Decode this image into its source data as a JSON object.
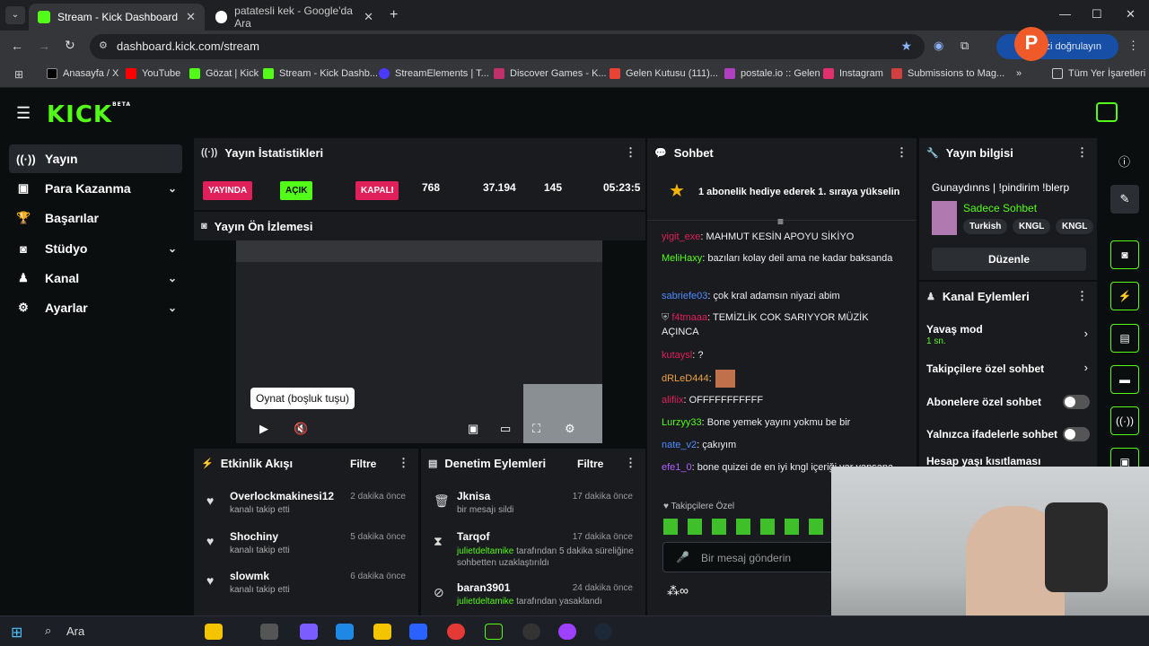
{
  "browser": {
    "tabs": [
      {
        "title": "Stream - Kick Dashboard"
      },
      {
        "title": "patatesli kek - Google'da Ara"
      }
    ],
    "url": "dashboard.kick.com/stream",
    "profile_prompt": "nizi doğrulayın",
    "bookmarks": [
      "Anasayfa / X",
      "YouTube",
      "Gözat | Kick",
      "Stream - Kick Dashb...",
      "StreamElements | T...",
      "Discover Games - K...",
      "Gelen Kutusu (111)...",
      "postale.io :: Gelen",
      "Instagram",
      "Submissions to Mag..."
    ],
    "all_bookmarks": "Tüm Yer İşaretleri"
  },
  "kick": {
    "logo": "KICK",
    "beta": "BETA"
  },
  "sidebar": {
    "items": [
      {
        "label": "Yayın"
      },
      {
        "label": "Para Kazanma"
      },
      {
        "label": "Başarılar"
      },
      {
        "label": "Stüdyo"
      },
      {
        "label": "Kanal"
      },
      {
        "label": "Ayarlar"
      }
    ]
  },
  "stats": {
    "title": "Yayın İstatistikleri",
    "live": "YAYINDA",
    "on": "AÇIK",
    "off": "KAPALI",
    "viewers": "768",
    "followers": "37.194",
    "subs": "145",
    "duration": "05:23:5"
  },
  "preview": {
    "title": "Yayın Ön İzlemesi",
    "tooltip": "Oynat (boşluk tuşu)"
  },
  "activity": {
    "title": "Etkinlik Akışı",
    "filter": "Filtre",
    "items": [
      {
        "name": "Overlockmakinesi12",
        "sub": "kanalı takip etti",
        "time": "2 dakika önce"
      },
      {
        "name": "Shochiny",
        "sub": "kanalı takip etti",
        "time": "5 dakika önce"
      },
      {
        "name": "slowmk",
        "sub": "kanalı takip etti",
        "time": "6 dakika önce"
      }
    ]
  },
  "moderation": {
    "title": "Denetim Eylemleri",
    "filter": "Filtre",
    "items": [
      {
        "name": "Jknisa",
        "sub": "bir mesajı sildi",
        "time": "17 dakika önce"
      },
      {
        "name": "Tarqof",
        "actor": "julietdeltamike",
        "sub": " tarafından 5 dakika süreliğine sohbetten uzaklaştırıldı",
        "time": "17 dakika önce"
      },
      {
        "name": "baran3901",
        "actor": "julietdeltamike",
        "sub": " tarafından yasaklandı",
        "time": "24 dakika önce"
      }
    ]
  },
  "chat": {
    "title": "Sohbet",
    "pinned": "1 abonelik hediye ederek 1. sıraya yükselin",
    "messages": [
      {
        "user": "yigit_exe",
        "color": "#e0205a",
        "text": ": MAHMUT KESİN APOYU SİKİYO"
      },
      {
        "user": "MeliHaxy",
        "color": "#53fc18",
        "text": ": bazıları kolay deil ama ne kadar baksanda"
      },
      {
        "user": "sabriefe03",
        "color": "#4e8cff",
        "text": ": çok kral adamsın niyazi abim"
      },
      {
        "user": "f4tmaaa",
        "color": "#e0205a",
        "text": ": TEMİZLİK COK SARIYYOR MÜZİK AÇINCA"
      },
      {
        "user": "kutaysl",
        "color": "#e0205a",
        "text": ": ?"
      },
      {
        "user": "dRLeD444",
        "color": "#f0a040",
        "text": ":"
      },
      {
        "user": "alifiix",
        "color": "#e0205a",
        "text": ": OFFFFFFFFFFF"
      },
      {
        "user": "Lurzyy33",
        "color": "#53fc18",
        "text": ": Bone yemek yayını yokmu be bir"
      },
      {
        "user": "nate_v2",
        "color": "#4e8cff",
        "text": ": çakıyım"
      },
      {
        "user": "efe1_0",
        "color": "#b060ff",
        "text": ": bone quizei de en iyi kngl içeriği var yapsana"
      }
    ],
    "followers_only": "Takipçilere Özel",
    "input_placeholder": "Bir mesaj gönderin"
  },
  "info": {
    "title": "Yayın bilgisi",
    "stream_title": "Gunaydınns | !pindirim !blerp",
    "category": "Sadece Sohbet",
    "tags": [
      "Turkish",
      "KNGL",
      "KNGL"
    ],
    "edit": "Düzenle"
  },
  "channel_actions": {
    "title": "Kanal Eylemleri",
    "slow_mode": "Yavaş mod",
    "slow_value": "1 sn.",
    "followers_chat": "Takipçilere özel sohbet",
    "subs_chat": "Abonelere özel sohbet",
    "emote_chat": "Yalnızca ifadelerle sohbet",
    "age": "Hesap yaşı kısıtlaması"
  },
  "taskbar": {
    "search": "Ara"
  }
}
